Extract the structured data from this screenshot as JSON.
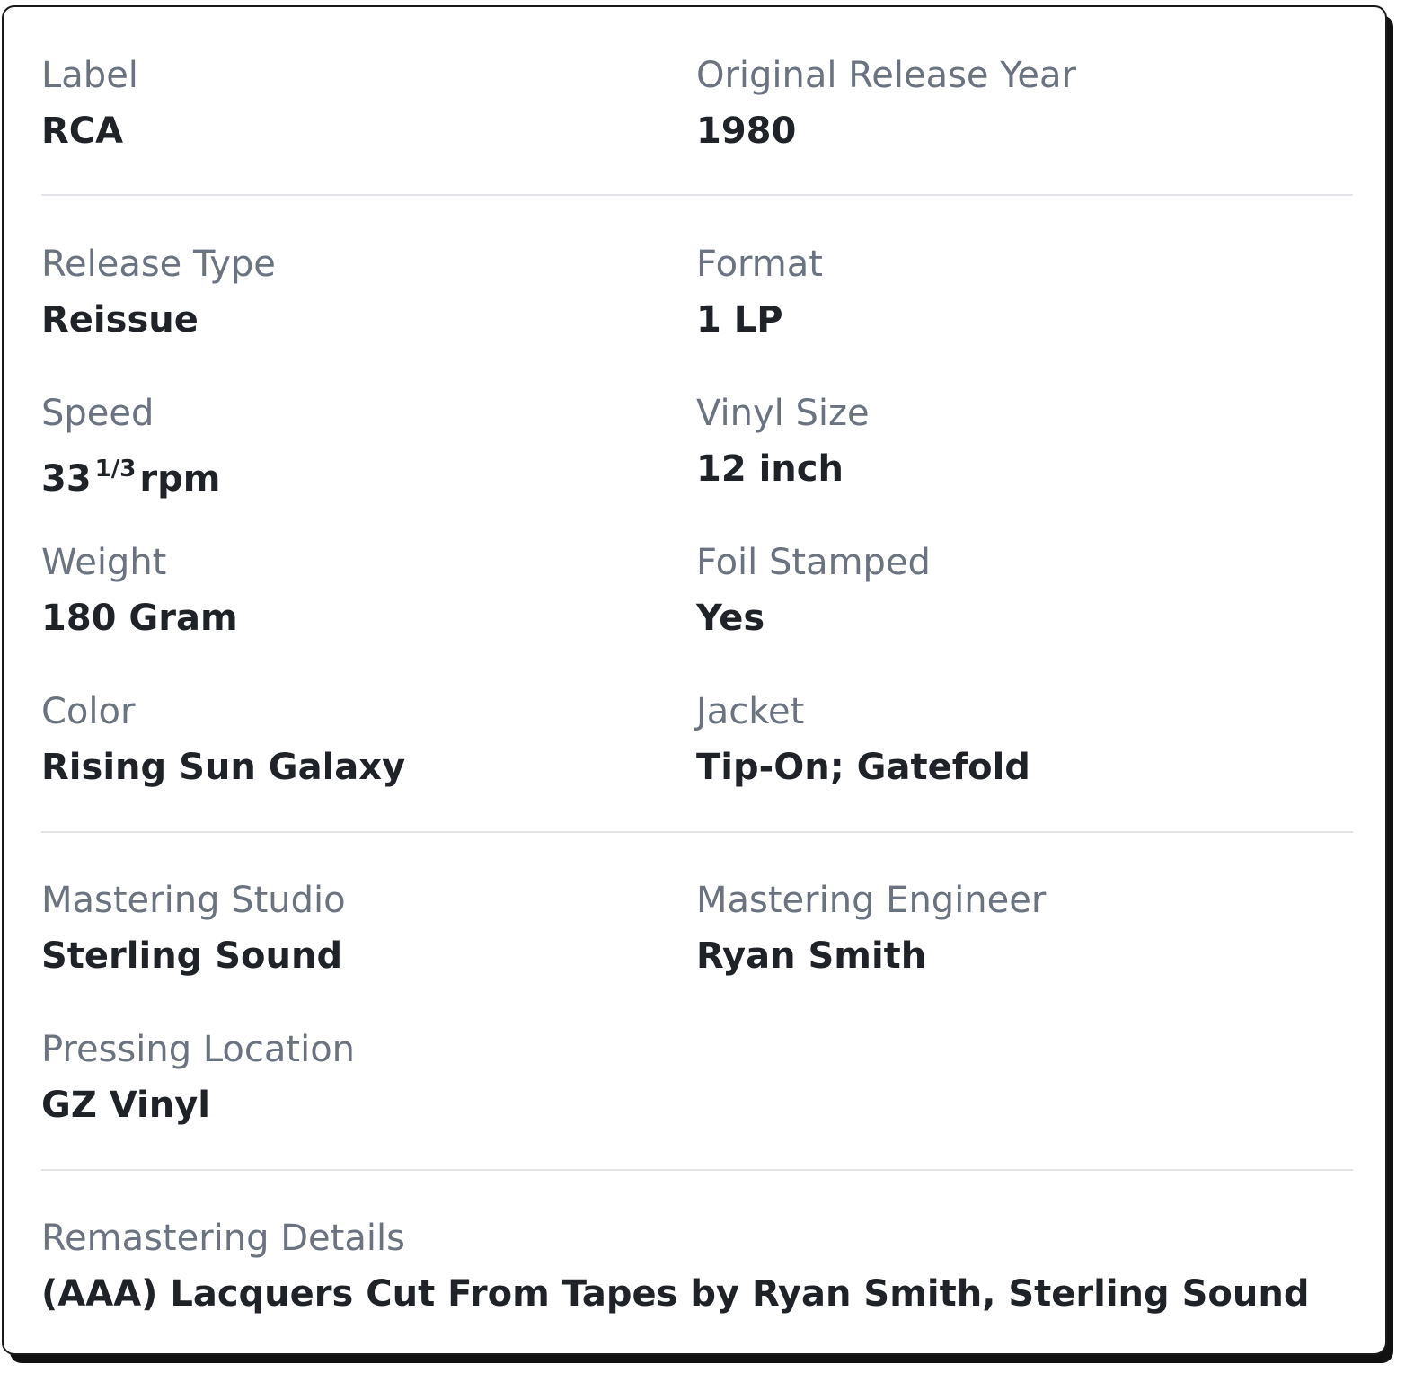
{
  "details": {
    "label": {
      "label": "Label",
      "value": "RCA"
    },
    "original_release_year": {
      "label": "Original Release Year",
      "value": "1980"
    },
    "release_type": {
      "label": "Release Type",
      "value": "Reissue"
    },
    "format": {
      "label": "Format",
      "value": "1 LP"
    },
    "speed": {
      "label": "Speed",
      "value_main": "33",
      "value_fraction": "1/3",
      "value_unit": "rpm"
    },
    "vinyl_size": {
      "label": "Vinyl Size",
      "value": "12 inch"
    },
    "weight": {
      "label": "Weight",
      "value": "180 Gram"
    },
    "foil_stamped": {
      "label": "Foil Stamped",
      "value": "Yes"
    },
    "color": {
      "label": "Color",
      "value": "Rising Sun Galaxy"
    },
    "jacket": {
      "label": "Jacket",
      "value": "Tip-On; Gatefold"
    },
    "mastering_studio": {
      "label": "Mastering Studio",
      "value": "Sterling Sound"
    },
    "mastering_engineer": {
      "label": "Mastering Engineer",
      "value": "Ryan Smith"
    },
    "pressing_location": {
      "label": "Pressing Location",
      "value": "GZ Vinyl"
    },
    "remastering_details": {
      "label": "Remastering Details",
      "value": "(AAA) Lacquers Cut From Tapes by Ryan Smith, Sterling Sound"
    }
  }
}
